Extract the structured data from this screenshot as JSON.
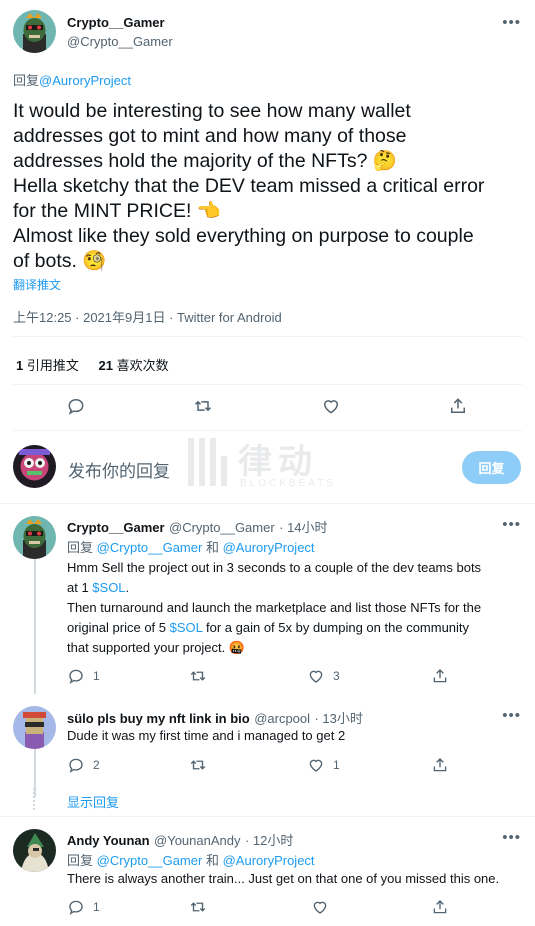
{
  "main_tweet": {
    "display_name": "Crypto__Gamer",
    "handle": "@Crypto__Gamer",
    "reply_prefix": "回复",
    "reply_to": "@AuroryProject",
    "text_lines": [
      "It would be interesting to see how many wallet",
      "addresses got to mint and how many of those",
      "addresses hold the majority of the NFTs? 🤔",
      "Hella sketchy that the DEV team missed a critical error",
      "for the MINT PRICE! 👈",
      "Almost like they sold everything on purpose to couple",
      "of bots. 🧐"
    ],
    "translate_label": "翻译推文",
    "timestamp": "上午12:25 · 2021年9月1日 · Twitter for Android",
    "quote_count": "1",
    "quote_label": "引用推文",
    "like_count": "21",
    "like_label": "喜欢次数"
  },
  "reply_composer": {
    "placeholder": "发布你的回复",
    "button_label": "回复"
  },
  "watermark": {
    "cn_text": "律动",
    "en_text": "BLOCKBEATS"
  },
  "replies": [
    {
      "display_name": "Crypto__Gamer",
      "handle": "@Crypto__Gamer",
      "time": "· 14小时",
      "reply_prefix": "回复",
      "reply_to_1": "@Crypto__Gamer",
      "reply_and": "和",
      "reply_to_2": "@AuroryProject",
      "lines": [
        {
          "a": "Hmm Sell the project out in 3 seconds to a couple of the dev teams bots",
          "link": "",
          "b": ""
        },
        {
          "a": "at 1 ",
          "link": "$SOL",
          "b": "."
        },
        {
          "a": "Then turnaround and launch the marketplace and list those NFTs for the",
          "link": "",
          "b": ""
        },
        {
          "a": "original price of 5 ",
          "link": "$SOL",
          "b": " for a gain of 5x by dumping on the community"
        },
        {
          "a": "that supported your project. 🤬",
          "link": "",
          "b": ""
        }
      ],
      "reply_count": "1",
      "retweet_count": "",
      "like_count": "3"
    },
    {
      "display_name": "sülo pls buy my nft link in bio",
      "handle": "@arcpool",
      "time": "· 13小时",
      "text": "Dude it was my first time and i managed to get 2",
      "reply_count": "2",
      "retweet_count": "",
      "like_count": "1"
    },
    {
      "display_name": "Andy Younan",
      "handle": "@YounanAndy",
      "time": "· 12小时",
      "reply_prefix": "回复",
      "reply_to_1": "@Crypto__Gamer",
      "reply_and": "和",
      "reply_to_2": "@AuroryProject",
      "text": "There is always another train... Just get on that one of you missed this one.",
      "reply_count": "1",
      "retweet_count": "",
      "like_count": ""
    }
  ],
  "show_replies_label": "显示回复",
  "colors": {
    "link": "#1d9bf0",
    "muted": "#536471",
    "button_disabled": "#8ecdf8",
    "divider": "#eff3f4"
  },
  "icons": [
    "more-icon",
    "reply-icon",
    "retweet-icon",
    "like-icon",
    "share-icon"
  ]
}
